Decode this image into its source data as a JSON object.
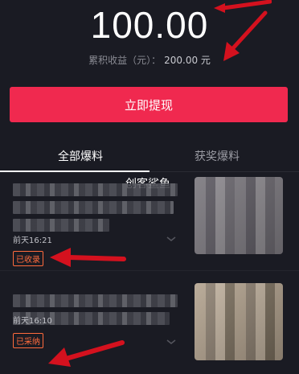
{
  "balance": "100.00",
  "cumulative": {
    "label": "累积收益（元）：",
    "value": "200.00 元"
  },
  "withdraw_button": "立即提现",
  "tabs": [
    {
      "label": "全部爆料"
    },
    {
      "label": "获奖爆料"
    }
  ],
  "watermark_top": "创客鲨鱼",
  "items": [
    {
      "time": "前天16:21",
      "status": "已收录"
    },
    {
      "time": "前天16:10",
      "status": "已采纳"
    }
  ],
  "colors": {
    "background": "#1a1b23",
    "accent": "#f0294f",
    "status": "#ff6b3d",
    "arrow": "#d4111e"
  }
}
